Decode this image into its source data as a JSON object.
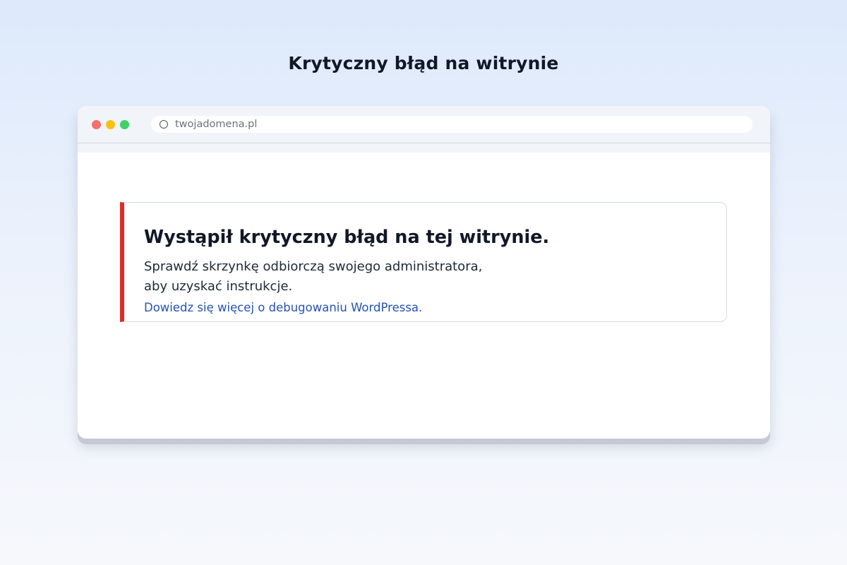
{
  "page": {
    "heading": "Krytyczny błąd na witrynie"
  },
  "browser": {
    "url": "twojadomena.pl",
    "colors": {
      "close": "#f2706f",
      "minimize": "#f7c213",
      "maximize": "#3fd06b"
    }
  },
  "error": {
    "title": "Wystąpił krytyczny błąd na tej witrynie.",
    "message_line_1": "Sprawdź skrzynkę odbiorczą swojego administratora,",
    "message_line_2": "aby uzyskać instrukcje.",
    "link_text": "Dowiedz się więcej o debugowaniu WordPressa.",
    "accent_color": "#dc2b2b",
    "link_color": "#2453b3"
  }
}
